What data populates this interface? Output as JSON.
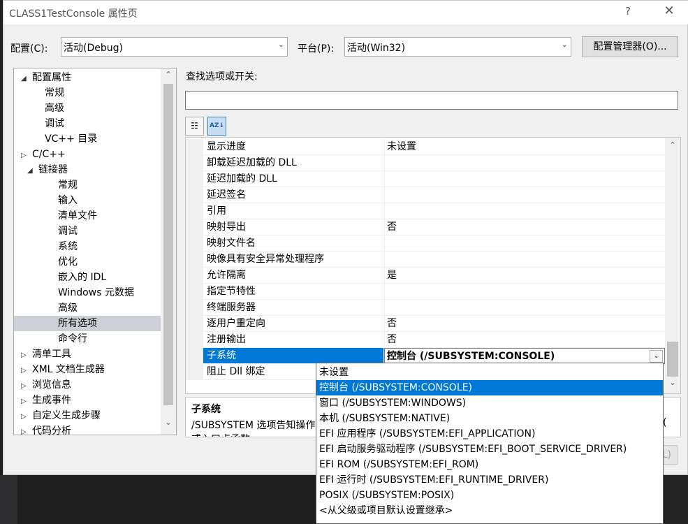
{
  "window": {
    "title": "CLASS1TestConsole 属性页",
    "help_label": "?",
    "close_label": "✕"
  },
  "config_bar": {
    "config_label": "配置(C):",
    "config_value": "活动(Debug)",
    "platform_label": "平台(P):",
    "platform_value": "活动(Win32)",
    "manager_button": "配置管理器(O)..."
  },
  "tree": {
    "items": [
      {
        "label": "配置属性",
        "glyph": "◢"
      },
      {
        "label": "常规",
        "glyph": ""
      },
      {
        "label": "高级",
        "glyph": ""
      },
      {
        "label": "调试",
        "glyph": ""
      },
      {
        "label": "VC++ 目录",
        "glyph": ""
      },
      {
        "label": "C/C++",
        "glyph": "▷"
      },
      {
        "label": "链接器",
        "glyph": "◢"
      },
      {
        "label": "常规",
        "glyph": ""
      },
      {
        "label": "输入",
        "glyph": ""
      },
      {
        "label": "清单文件",
        "glyph": ""
      },
      {
        "label": "调试",
        "glyph": ""
      },
      {
        "label": "系统",
        "glyph": ""
      },
      {
        "label": "优化",
        "glyph": ""
      },
      {
        "label": "嵌入的 IDL",
        "glyph": ""
      },
      {
        "label": "Windows 元数据",
        "glyph": ""
      },
      {
        "label": "高级",
        "glyph": ""
      },
      {
        "label": "所有选项",
        "glyph": ""
      },
      {
        "label": "命令行",
        "glyph": ""
      },
      {
        "label": "清单工具",
        "glyph": "▷"
      },
      {
        "label": "XML 文档生成器",
        "glyph": "▷"
      },
      {
        "label": "浏览信息",
        "glyph": "▷"
      },
      {
        "label": "生成事件",
        "glyph": "▷"
      },
      {
        "label": "自定义生成步骤",
        "glyph": "▷"
      },
      {
        "label": "代码分析",
        "glyph": "▷"
      }
    ],
    "scroll_up": "⌃",
    "scroll_down": "⌄"
  },
  "search": {
    "label": "查找选项或开关:",
    "value": ""
  },
  "toolbar": {
    "categorized_glyph": "☷",
    "alpha_glyph": "AZ↓"
  },
  "grid": {
    "rows": [
      {
        "name": "显示进度",
        "value": "未设置"
      },
      {
        "name": "卸载延迟加载的 DLL",
        "value": ""
      },
      {
        "name": "延迟加载的 DLL",
        "value": ""
      },
      {
        "name": "延迟签名",
        "value": ""
      },
      {
        "name": "引用",
        "value": ""
      },
      {
        "name": "映射导出",
        "value": "否"
      },
      {
        "name": "映射文件名",
        "value": ""
      },
      {
        "name": "映像具有安全异常处理程序",
        "value": ""
      },
      {
        "name": "允许隔离",
        "value": "是"
      },
      {
        "name": "指定节特性",
        "value": ""
      },
      {
        "name": "终端服务器",
        "value": ""
      },
      {
        "name": "逐用户重定向",
        "value": "否"
      },
      {
        "name": "注册输出",
        "value": "否"
      },
      {
        "name": "子系统",
        "value": "控制台 (/SUBSYSTEM:CONSOLE)"
      },
      {
        "name": "阻止 Dll 绑定",
        "value": ""
      }
    ],
    "scroll_up": "⌃",
    "scroll_down": "⌄",
    "dropdown_glyph": "⌄"
  },
  "description": {
    "title": "子系统",
    "text": "/SUBSYSTEM 选项告知操作",
    "text2": "或入口点函数",
    "edge_text": "(",
    "apply_fragment": "L)"
  },
  "dropdown": {
    "options": [
      "未设置",
      "控制台 (/SUBSYSTEM:CONSOLE)",
      "窗口 (/SUBSYSTEM:WINDOWS)",
      "本机 (/SUBSYSTEM:NATIVE)",
      "EFI 应用程序 (/SUBSYSTEM:EFI_APPLICATION)",
      "EFI 启动服务驱动程序 (/SUBSYSTEM:EFI_BOOT_SERVICE_DRIVER)",
      "EFI ROM (/SUBSYSTEM:EFI_ROM)",
      "EFI 运行时 (/SUBSYSTEM:EFI_RUNTIME_DRIVER)",
      "POSIX (/SUBSYSTEM:POSIX)",
      "<从父级或项目默认设置继承>"
    ],
    "highlighted": "控制台 (/SUBSYSTEM:CONSOLE)"
  },
  "colors": {
    "selection": "#0078d7",
    "tree_selection": "#cdcfd7",
    "dialog_bg": "#f0f0f0"
  }
}
